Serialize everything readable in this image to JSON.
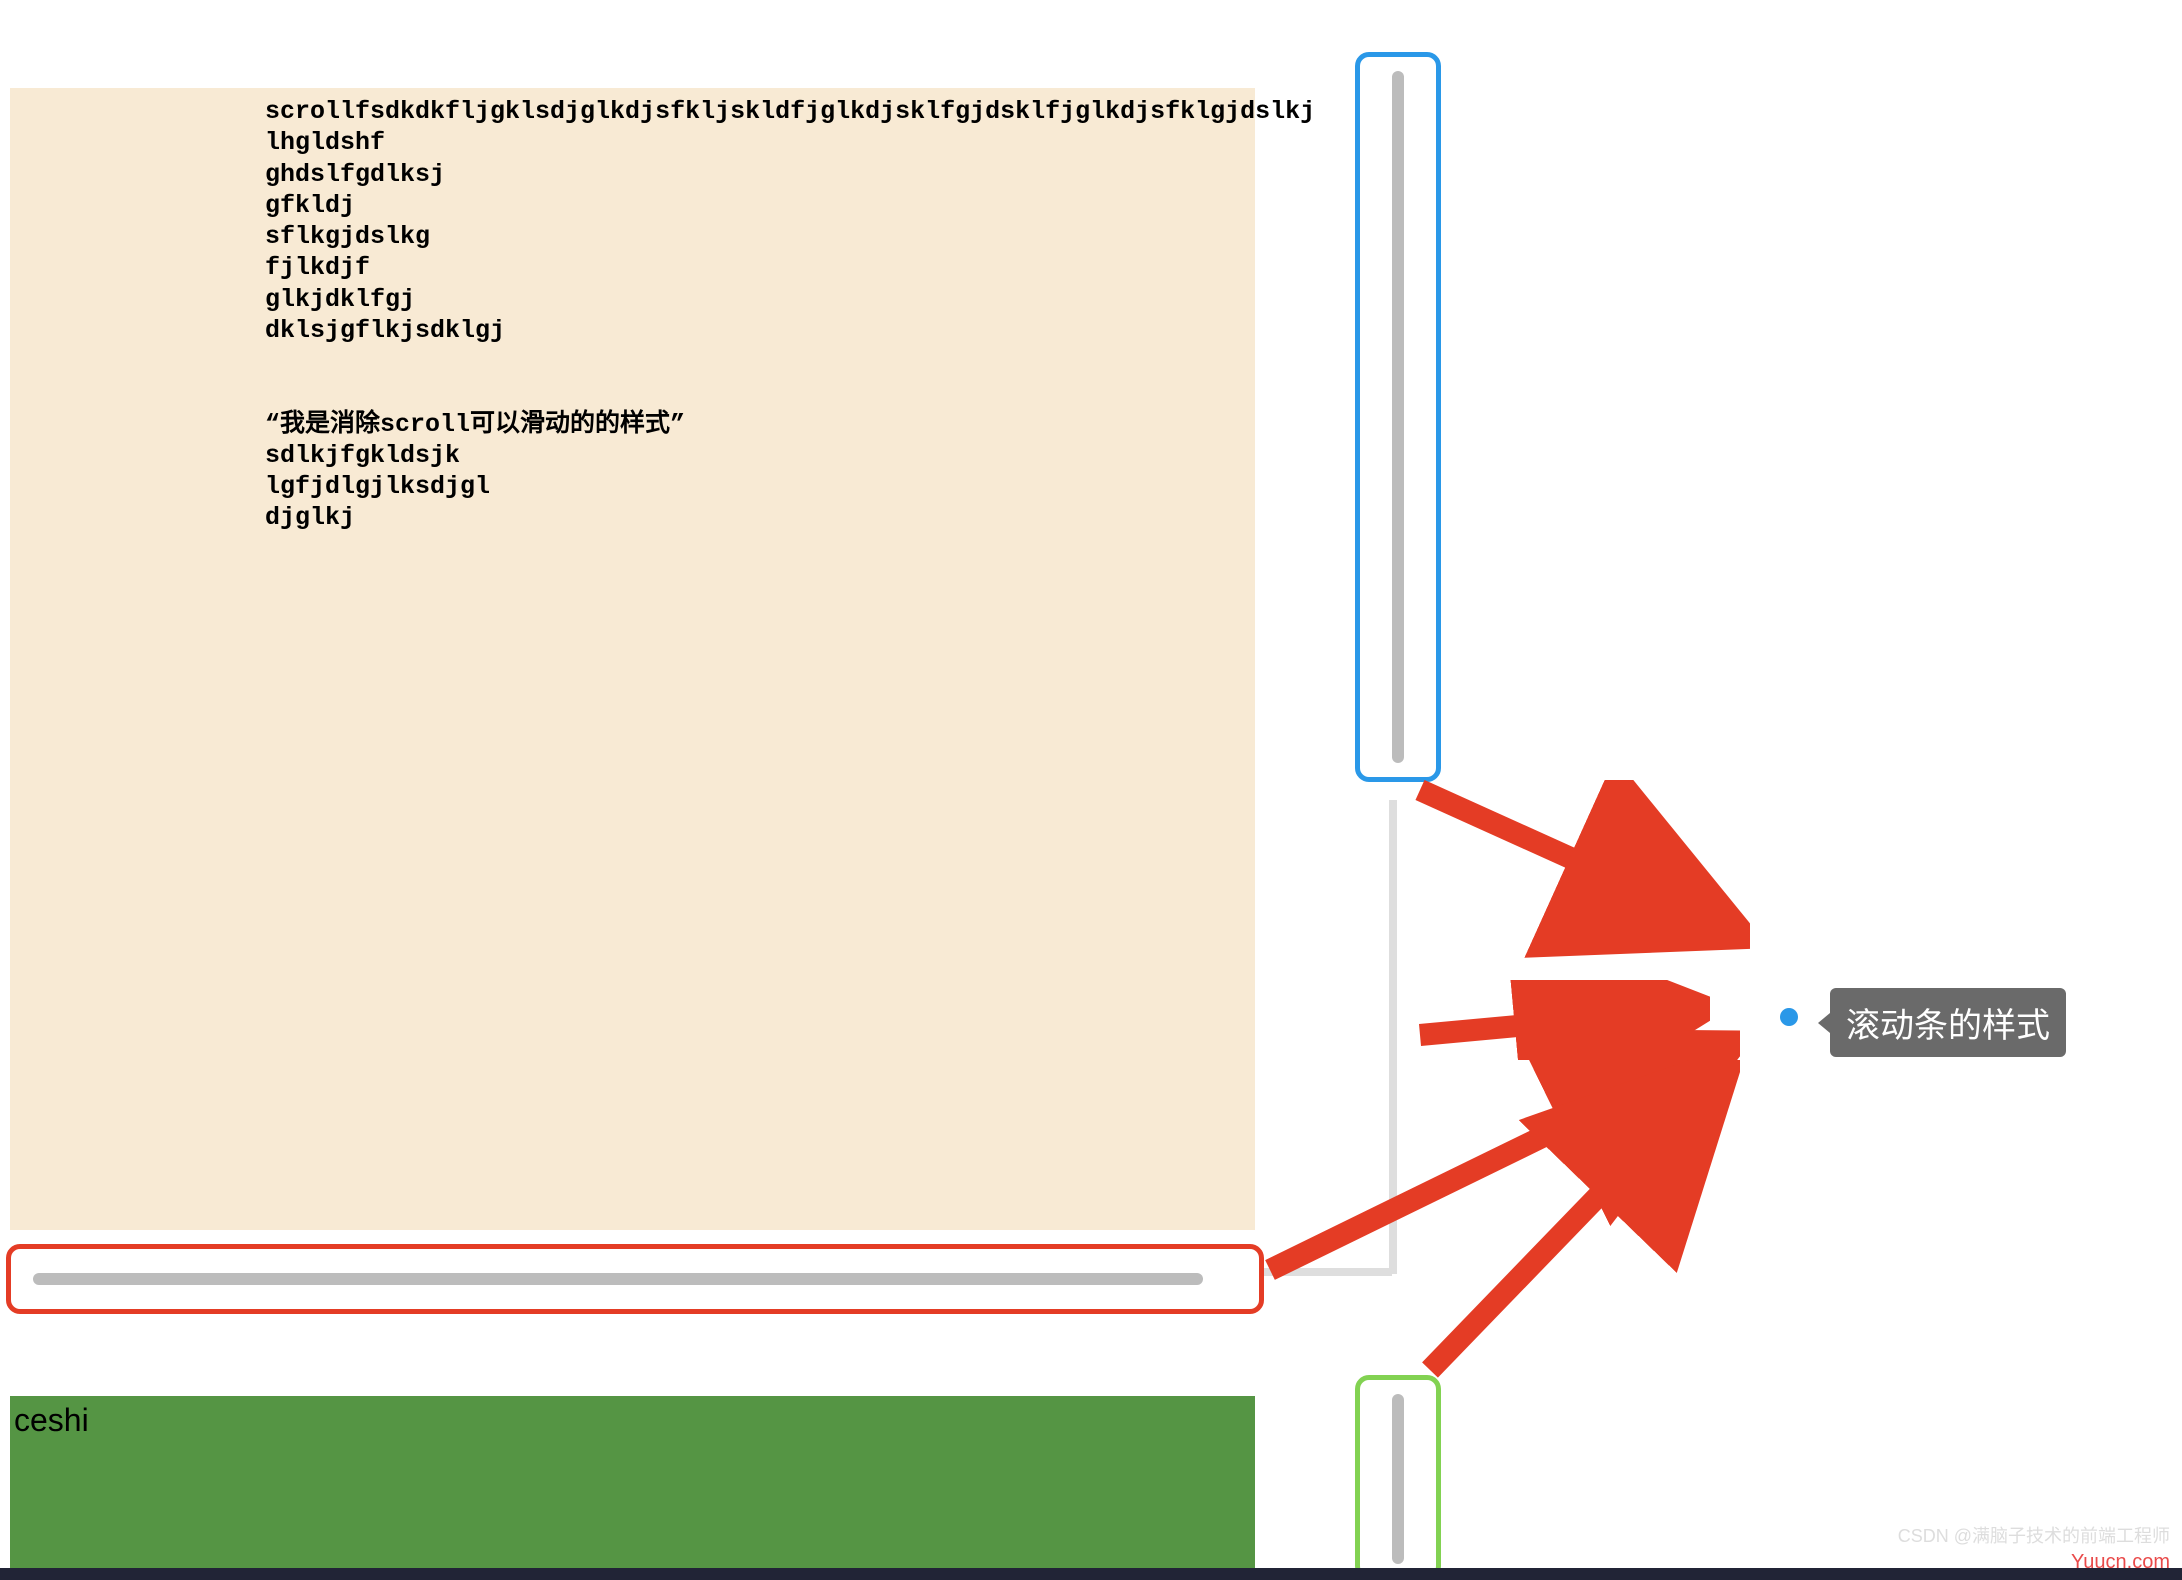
{
  "panel1": {
    "lines": [
      "scrollfsdkdkfljgklsdjglkdjsfkljskldfjglkdjsklfgjdsklfjglkdjsfklgjdslkj",
      "lhgldshf",
      "ghdslfgdlksj",
      "gfkldj",
      "sflkgjdslkg",
      "fjlkdjf",
      "glkjdklfgj",
      "dklsjgflkjsdklgj",
      "",
      "",
      "“我是消除scroll可以滑动的的样式”",
      "sdlkjfgkldsjk",
      "lgfjdlgjlksdjgl",
      "djglkj"
    ]
  },
  "panel2": {
    "label": "ceshi"
  },
  "tooltip": {
    "text": "滚动条的样式"
  },
  "watermark": {
    "site": "Yuucn.com",
    "csdn": "CSDN @满脑子技术的前端工程师"
  },
  "colors": {
    "antiquewhite": "#f8ead4",
    "green": "#559544",
    "arrow": "#e43c25",
    "blueBorder": "#2a98e8",
    "greenBorder": "#82d252"
  }
}
